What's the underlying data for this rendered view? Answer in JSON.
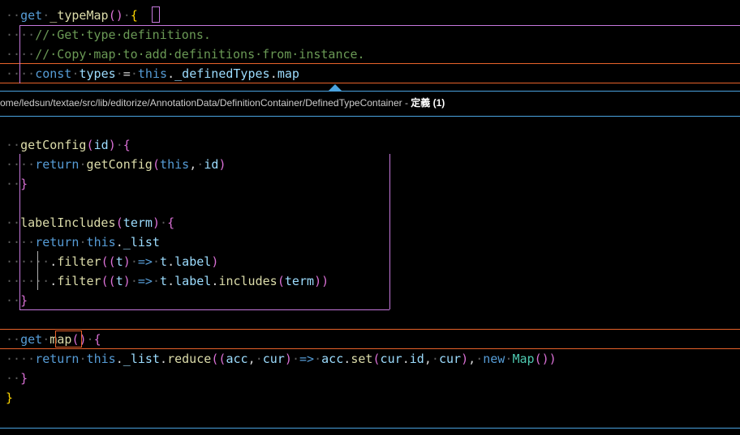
{
  "top_editor": {
    "lines": [
      {
        "ws": "··",
        "parts": [
          [
            "kw",
            "get"
          ],
          [
            "ws",
            "·"
          ],
          [
            "fn",
            "_typeMap"
          ],
          [
            "pn",
            "()"
          ],
          [
            "ws",
            "·"
          ],
          [
            "br",
            "{"
          ]
        ]
      },
      {
        "ws": "··",
        "parts": [
          [
            "ws",
            "··"
          ],
          [
            "cm",
            "//·Get·type·definitions."
          ]
        ]
      },
      {
        "ws": "··",
        "parts": [
          [
            "ws",
            "··"
          ],
          [
            "cm",
            "//·Copy·map·to·add·definitions·from·instance."
          ]
        ]
      },
      {
        "ws": "··",
        "parts": [
          [
            "ws",
            "··"
          ],
          [
            "kw",
            "const"
          ],
          [
            "ws",
            "·"
          ],
          [
            "vr",
            "types"
          ],
          [
            "ws",
            "·"
          ],
          [
            "op",
            "="
          ],
          [
            "ws",
            "·"
          ],
          [
            "kw",
            "this"
          ],
          [
            "op",
            "."
          ],
          [
            "vr",
            "_definedTypes"
          ],
          [
            "op",
            "."
          ],
          [
            "vr",
            "map"
          ]
        ]
      }
    ]
  },
  "peek": {
    "path": "ome/ledsun/textae/src/lib/editorize/AnnotationData/DefinitionContainer/DefinedTypeContainer",
    "separator": " - ",
    "title": "定義 (1)"
  },
  "peek_editor": {
    "lines": [
      {
        "parts": []
      },
      {
        "parts": [
          [
            "ws",
            "··"
          ],
          [
            "fn",
            "getConfig"
          ],
          [
            "pn",
            "("
          ],
          [
            "vr",
            "id"
          ],
          [
            "pn",
            ")"
          ],
          [
            "ws",
            "·"
          ],
          [
            "pn",
            "{"
          ]
        ]
      },
      {
        "parts": [
          [
            "ws",
            "····"
          ],
          [
            "kw",
            "return"
          ],
          [
            "ws",
            "·"
          ],
          [
            "fn",
            "getConfig"
          ],
          [
            "pn",
            "("
          ],
          [
            "kw",
            "this"
          ],
          [
            "op",
            ","
          ],
          [
            "ws",
            "·"
          ],
          [
            "vr",
            "id"
          ],
          [
            "pn",
            ")"
          ]
        ]
      },
      {
        "parts": [
          [
            "ws",
            "··"
          ],
          [
            "pn",
            "}"
          ]
        ]
      },
      {
        "parts": []
      },
      {
        "parts": [
          [
            "ws",
            "··"
          ],
          [
            "fn",
            "labelIncludes"
          ],
          [
            "pn",
            "("
          ],
          [
            "vr",
            "term"
          ],
          [
            "pn",
            ")"
          ],
          [
            "ws",
            "·"
          ],
          [
            "pn",
            "{"
          ]
        ]
      },
      {
        "parts": [
          [
            "ws",
            "····"
          ],
          [
            "kw",
            "return"
          ],
          [
            "ws",
            "·"
          ],
          [
            "kw",
            "this"
          ],
          [
            "op",
            "."
          ],
          [
            "vr",
            "_list"
          ]
        ]
      },
      {
        "parts": [
          [
            "ws",
            "······"
          ],
          [
            "op",
            "."
          ],
          [
            "fn",
            "filter"
          ],
          [
            "pn",
            "(("
          ],
          [
            "vr",
            "t"
          ],
          [
            "pn",
            ")"
          ],
          [
            "ws",
            "·"
          ],
          [
            "kw",
            "=>"
          ],
          [
            "ws",
            "·"
          ],
          [
            "vr",
            "t"
          ],
          [
            "op",
            "."
          ],
          [
            "vr",
            "label"
          ],
          [
            "pn",
            ")"
          ]
        ]
      },
      {
        "parts": [
          [
            "ws",
            "······"
          ],
          [
            "op",
            "."
          ],
          [
            "fn",
            "filter"
          ],
          [
            "pn",
            "(("
          ],
          [
            "vr",
            "t"
          ],
          [
            "pn",
            ")"
          ],
          [
            "ws",
            "·"
          ],
          [
            "kw",
            "=>"
          ],
          [
            "ws",
            "·"
          ],
          [
            "vr",
            "t"
          ],
          [
            "op",
            "."
          ],
          [
            "vr",
            "label"
          ],
          [
            "op",
            "."
          ],
          [
            "fn",
            "includes"
          ],
          [
            "pn",
            "("
          ],
          [
            "vr",
            "term"
          ],
          [
            "pn",
            "))"
          ]
        ]
      },
      {
        "parts": [
          [
            "ws",
            "··"
          ],
          [
            "pn",
            "}"
          ]
        ]
      },
      {
        "parts": []
      },
      {
        "parts": [
          [
            "ws",
            "··"
          ],
          [
            "kw",
            "get"
          ],
          [
            "ws",
            "·"
          ],
          [
            "fn",
            "map"
          ],
          [
            "pn",
            "()"
          ],
          [
            "ws",
            "·"
          ],
          [
            "pn",
            "{"
          ]
        ]
      },
      {
        "parts": [
          [
            "ws",
            "····"
          ],
          [
            "kw",
            "return"
          ],
          [
            "ws",
            "·"
          ],
          [
            "kw",
            "this"
          ],
          [
            "op",
            "."
          ],
          [
            "vr",
            "_list"
          ],
          [
            "op",
            "."
          ],
          [
            "fn",
            "reduce"
          ],
          [
            "pn",
            "(("
          ],
          [
            "vr",
            "acc"
          ],
          [
            "op",
            ","
          ],
          [
            "ws",
            "·"
          ],
          [
            "vr",
            "cur"
          ],
          [
            "pn",
            ")"
          ],
          [
            "ws",
            "·"
          ],
          [
            "kw",
            "=>"
          ],
          [
            "ws",
            "·"
          ],
          [
            "vr",
            "acc"
          ],
          [
            "op",
            "."
          ],
          [
            "fn",
            "set"
          ],
          [
            "pn",
            "("
          ],
          [
            "vr",
            "cur"
          ],
          [
            "op",
            "."
          ],
          [
            "vr",
            "id"
          ],
          [
            "op",
            ","
          ],
          [
            "ws",
            "·"
          ],
          [
            "vr",
            "cur"
          ],
          [
            "pn",
            ")"
          ],
          [
            "op",
            ","
          ],
          [
            "ws",
            "·"
          ],
          [
            "kw",
            "new"
          ],
          [
            "ws",
            "·"
          ],
          [
            "cl",
            "Map"
          ],
          [
            "pn",
            "())"
          ]
        ]
      },
      {
        "parts": [
          [
            "ws",
            "··"
          ],
          [
            "pn",
            "}"
          ]
        ]
      },
      {
        "parts": [
          [
            "br",
            "}"
          ]
        ]
      }
    ]
  }
}
